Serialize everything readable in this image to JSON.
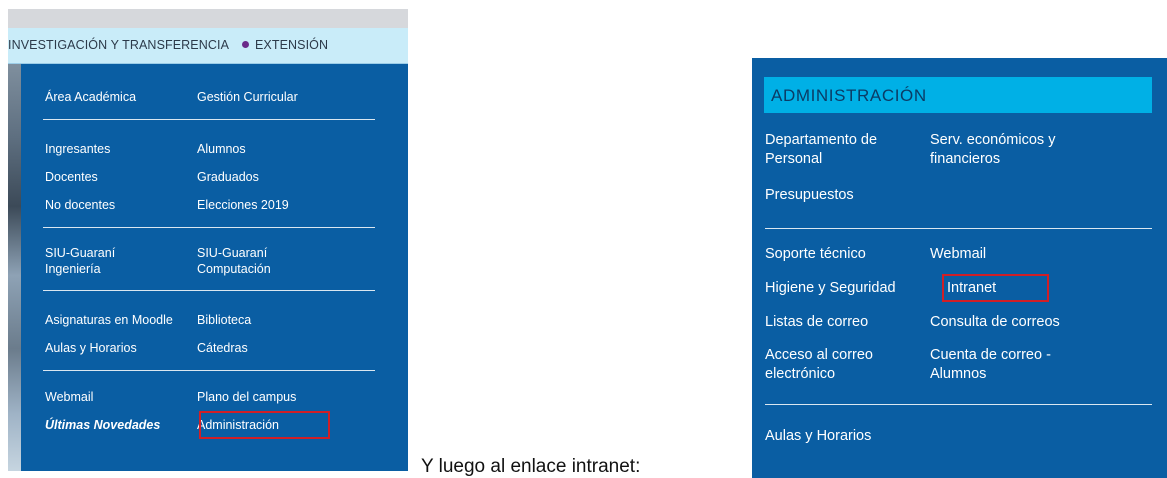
{
  "left_menu": {
    "nav": {
      "item1": "INVESTIGACIÓN Y TRANSFERENCIA",
      "item2": "EXTENSIÓN"
    },
    "links": {
      "area_academica": "Área Académica",
      "gestion_curricular": "Gestión Curricular",
      "ingresantes": "Ingresantes",
      "alumnos": "Alumnos",
      "docentes": "Docentes",
      "graduados": "Graduados",
      "no_docentes": "No docentes",
      "elecciones": "Elecciones 2019",
      "siu_ingenieria": "SIU-Guaraní\nIngeniería",
      "siu_computacion": "SIU-Guaraní\nComputación",
      "moodle": "Asignaturas en Moodle",
      "biblioteca": "Biblioteca",
      "aulas": "Aulas y Horarios",
      "catedras": "Cátedras",
      "webmail": "Webmail",
      "plano": "Plano del campus",
      "novedades": "Últimas Novedades",
      "administracion": "Administración"
    }
  },
  "caption": "Y luego al enlace intranet:",
  "right_menu": {
    "title": "ADMINISTRACIÓN",
    "links": {
      "personal": "Departamento de\nPersonal",
      "economicos": "Serv. económicos y\nfinancieros",
      "presupuestos": "Presupuestos",
      "soporte": "Soporte técnico",
      "webmail": "Webmail",
      "higiene": "Higiene y Seguridad",
      "intranet": "Intranet",
      "listas": "Listas de correo",
      "consulta": "Consulta de correos",
      "acceso": "Acceso al correo\nelectrónico",
      "cuenta": "Cuenta de correo -\nAlumnos",
      "aulas": "Aulas y Horarios"
    }
  },
  "colors": {
    "menu_bg": "#0a5ea3",
    "header_bg": "#00b0e6",
    "highlight": "#d11f26",
    "nav_bg": "#c9ecf9"
  }
}
